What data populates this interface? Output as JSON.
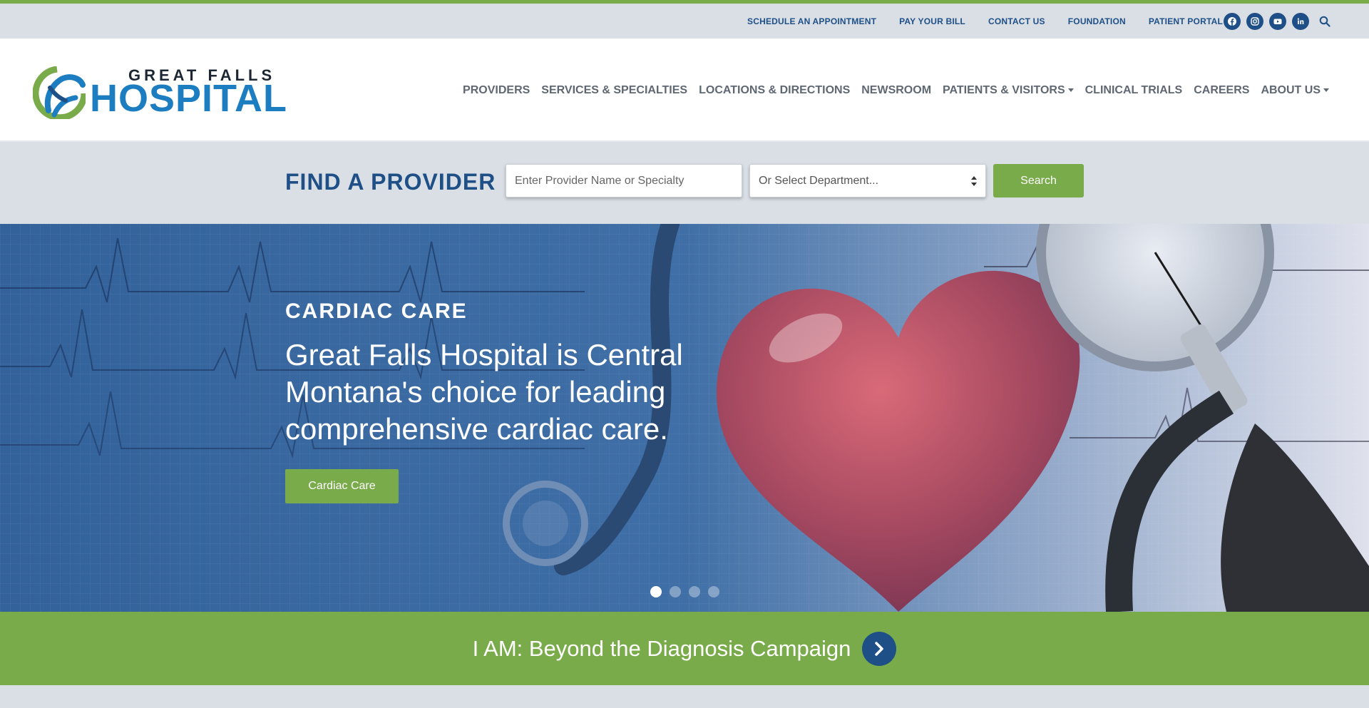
{
  "colors": {
    "brand_blue": "#1e4f87",
    "logo_blue": "#1c7dc1",
    "accent_green": "#7aab4b",
    "nav_gray": "#5f6872",
    "utility_bg": "#d9dfe5"
  },
  "utility": {
    "links": [
      "SCHEDULE AN APPOINTMENT",
      "PAY YOUR BILL",
      "CONTACT US",
      "FOUNDATION",
      "PATIENT PORTAL"
    ],
    "social_icons": [
      "facebook-icon",
      "instagram-icon",
      "youtube-icon",
      "linkedin-icon"
    ],
    "search_icon": "search-icon"
  },
  "logo": {
    "top": "GREAT FALLS",
    "main": "HOSPITAL"
  },
  "nav": {
    "items": [
      {
        "label": "PROVIDERS",
        "dropdown": false
      },
      {
        "label": "SERVICES & SPECIALTIES",
        "dropdown": false
      },
      {
        "label": "LOCATIONS & DIRECTIONS",
        "dropdown": false
      },
      {
        "label": "NEWSROOM",
        "dropdown": false
      },
      {
        "label": "PATIENTS & VISITORS",
        "dropdown": true
      },
      {
        "label": "CLINICAL TRIALS",
        "dropdown": false
      },
      {
        "label": "CAREERS",
        "dropdown": false
      },
      {
        "label": "ABOUT US",
        "dropdown": true
      }
    ]
  },
  "finder": {
    "title": "FIND A PROVIDER",
    "input_placeholder": "Enter Provider Name or Specialty",
    "select_value": "Or Select Department...",
    "button": "Search"
  },
  "hero": {
    "eyebrow": "CARDIAC CARE",
    "text": "Great Falls Hospital is Central Montana's choice for leading comprehensive cardiac care.",
    "button": "Cardiac Care",
    "slide_count": 4,
    "active_slide": 1
  },
  "campaign": {
    "text": "I AM: Beyond the Diagnosis Campaign",
    "icon": "chevron-right-icon"
  }
}
